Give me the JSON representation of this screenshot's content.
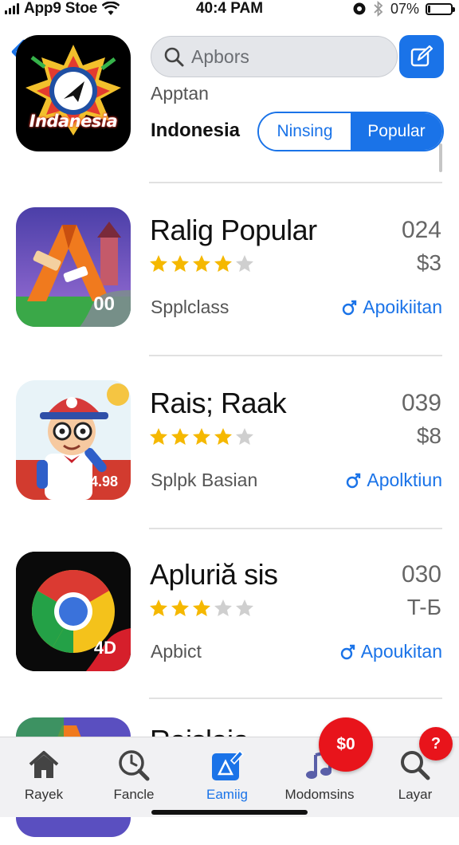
{
  "status_bar": {
    "carrier": "App9 Stoe",
    "time": "40:4 PAM",
    "battery_percent": "07%",
    "battery_level": 0.07
  },
  "header": {
    "search_placeholder": "Apbors",
    "subtitle": "Apptan",
    "region": "Indonesia",
    "segments": [
      {
        "label": "Ninsing",
        "selected": false
      },
      {
        "label": "Popular",
        "selected": true
      }
    ],
    "logo_text": "Indanesia"
  },
  "apps": [
    {
      "title": "Ralig Popular",
      "number": "024",
      "price": "$3",
      "rating": 4,
      "category": "Spplclass",
      "action": "Apoikiitan",
      "icon": "triangle-game-icon",
      "icon_badge": "00"
    },
    {
      "title": "Rais; Raak",
      "number": "039",
      "price": "$8",
      "rating": 4,
      "category": "Splpk Basian",
      "action": "Apolktiun",
      "icon": "cartoon-boy-icon",
      "icon_badge": "4.98"
    },
    {
      "title": "Apluriă sis",
      "number": "030",
      "price": "T-Б",
      "rating": 3,
      "category": "Apbict",
      "action": "Apoukitan",
      "icon": "chrome-icon",
      "icon_badge": "4D"
    },
    {
      "title": "Rajslaja",
      "icon": "triangle-game-icon"
    }
  ],
  "tabs": [
    {
      "label": "Rayek",
      "icon": "home-icon",
      "active": false
    },
    {
      "label": "Fancle",
      "icon": "clock-search-icon",
      "active": false
    },
    {
      "label": "Eamiig",
      "icon": "edit-triangle-icon",
      "active": true
    },
    {
      "label": "Modomsins",
      "icon": "music-note-icon",
      "active": false
    },
    {
      "label": "Layar",
      "icon": "search-icon",
      "active": false
    }
  ],
  "badges": {
    "cart": "$0",
    "help": "?"
  },
  "colors": {
    "accent": "#1a73e8",
    "star": "#f5b800",
    "star_empty": "#cfcfcf",
    "badge": "#e8141b"
  }
}
